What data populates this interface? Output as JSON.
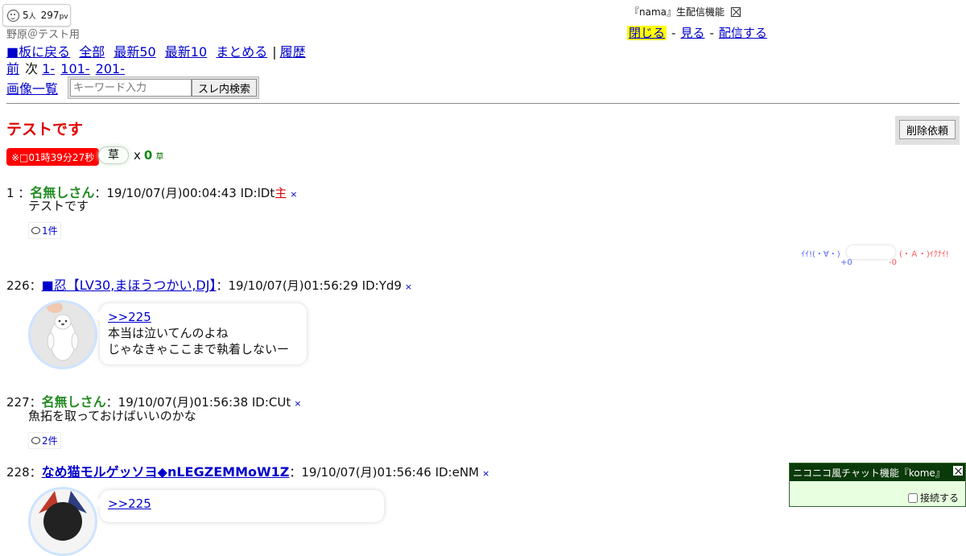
{
  "counter": {
    "people": "5",
    "people_unit": "人",
    "pv": "297",
    "pv_unit": "pv"
  },
  "board_name": "野原＠テスト用",
  "nav": {
    "back": "■板に戻る",
    "all": "全部",
    "latest50": "最新50",
    "latest10": "最新10",
    "summary": "まとめる",
    "separator": "|",
    "history": "履歴",
    "prev": "前",
    "next": "次",
    "range1": "1-",
    "range2": "101-",
    "range3": "201-",
    "images": "画像一覧"
  },
  "search": {
    "placeholder": "キーワード入力",
    "button": "スレ内検索"
  },
  "nama": {
    "title": "『nama』生配信機能",
    "close": "閉じる",
    "watch": "見る",
    "broadcast": "配信する",
    "dash": "-"
  },
  "thread": {
    "title": "テストです",
    "delete_request": "削除依頼",
    "timer": "※□01時39分27秒",
    "kusa_label": "草",
    "kusa_x": "x",
    "kusa_count": "0",
    "kusa_small": "草"
  },
  "vote": {
    "good_label": "ｲｲ!(・∀・)",
    "good_count": "+0",
    "bad_label": "(・Ａ・)ｲｸﾅｲ!",
    "bad_count": "-0"
  },
  "posts": [
    {
      "num": "1",
      "sep": "：",
      "name": "名無しさん",
      "meta": "：19/10/07(月)00:04:43 ID:lDt",
      "owner_mark": "主",
      "x": "×",
      "body": "テストです",
      "replies": "1件"
    },
    {
      "num": "226",
      "sep": "：",
      "name": "■忍【LV30,まほうつかい,DJ】",
      "meta": "：19/10/07(月)01:56:29 ID:Yd9",
      "x": "×",
      "anchor": ">>225",
      "line1": "本当は泣いてんのよね",
      "line2": "じゃなきゃここまで執着しないー"
    },
    {
      "num": "227",
      "sep": "：",
      "name": "名無しさん",
      "meta": "：19/10/07(月)01:56:38 ID:CUt",
      "x": "×",
      "body": "魚拓を取っておけばいいのかな",
      "replies": "2件"
    },
    {
      "num": "228",
      "sep": "：",
      "name": "なめ猫モルゲッソヨ◆nLEGZEMMoW1Z",
      "meta": "：19/10/07(月)01:56:46 ID:eNM",
      "x": "×",
      "anchor": ">>225"
    }
  ],
  "kome": {
    "title": "ニコニコ風チャット機能『kome』",
    "connect": "接続する"
  }
}
